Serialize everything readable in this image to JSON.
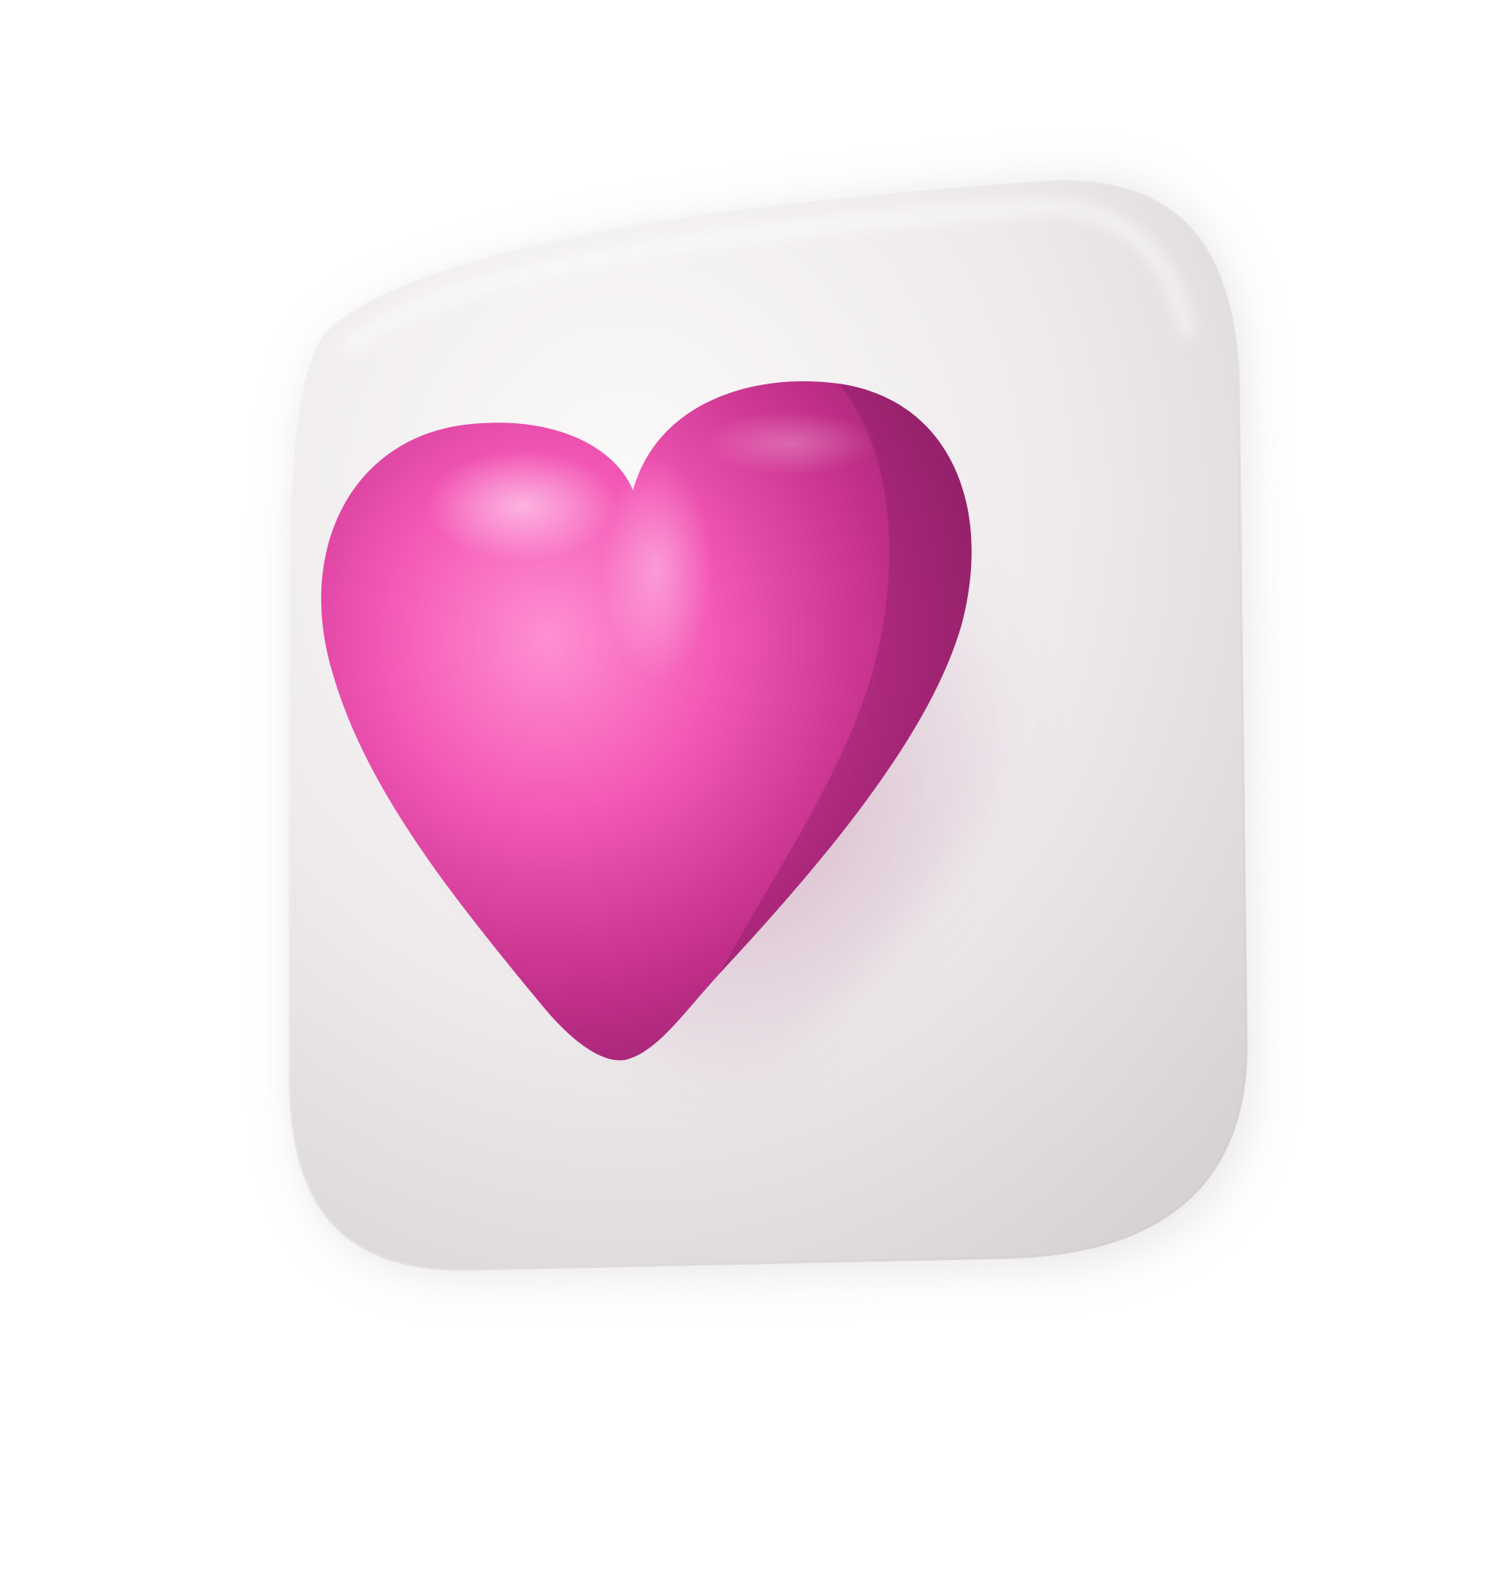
{
  "icon": {
    "name": "heart-icon",
    "tile_color": "#f2eff1",
    "tile_shadow_color": "#cfcacd",
    "heart_color": "#e0409f",
    "heart_highlight_color": "#ff7acb",
    "heart_shade_color": "#9e2470"
  }
}
